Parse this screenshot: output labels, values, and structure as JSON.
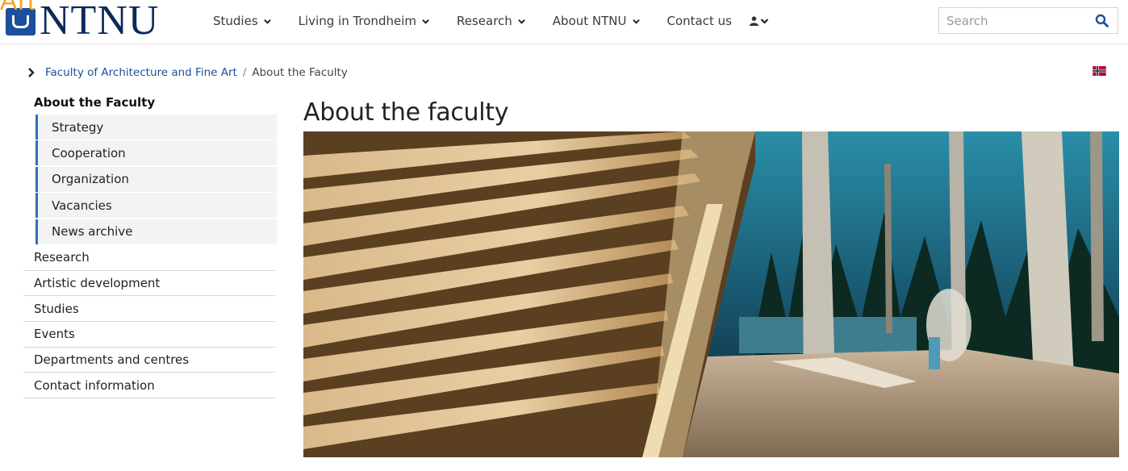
{
  "header": {
    "logo_text": "NTNU",
    "logo_overlay_text": "Art",
    "nav": [
      {
        "label": "Studies"
      },
      {
        "label": "Living in Trondheim"
      },
      {
        "label": "Research"
      },
      {
        "label": "About NTNU"
      },
      {
        "label": "Contact us"
      }
    ],
    "search": {
      "placeholder": "Search",
      "value": ""
    }
  },
  "breadcrumb": {
    "parent": "Faculty of Architecture and Fine Art",
    "separator": "/",
    "current": "About the Faculty"
  },
  "language_flag": "norwegian-flag-icon",
  "sidebar": {
    "heading": "About the Faculty",
    "subitems": [
      {
        "label": "Strategy"
      },
      {
        "label": "Cooperation"
      },
      {
        "label": "Organization"
      },
      {
        "label": "Vacancies"
      },
      {
        "label": "News archive"
      }
    ],
    "items": [
      {
        "label": "Research"
      },
      {
        "label": "Artistic development"
      },
      {
        "label": "Studies"
      },
      {
        "label": "Events"
      },
      {
        "label": "Departments and centres"
      },
      {
        "label": "Contact information"
      }
    ]
  },
  "main": {
    "title": "About the faculty"
  },
  "colors": {
    "brand_blue": "#1c4f9c",
    "link_blue": "#1c4f9c",
    "accent_bar": "#2f6fbd"
  }
}
